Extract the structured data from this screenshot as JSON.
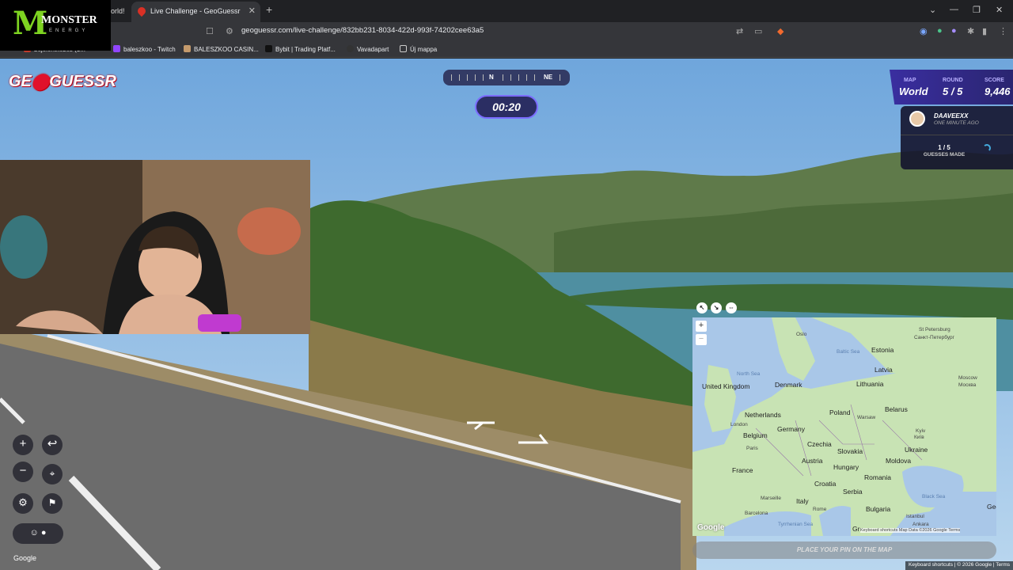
{
  "browser": {
    "prev_tab_label": "orld!",
    "active_tab_label": "Live Challenge - GeoGuessr",
    "url": "geoguessr.com/live-challenge/832bb231-8034-422d-993f-74202cee63a5",
    "bookmarks": [
      "bejelentkezés (1...",
      "baleszkoo - Twitch",
      "BALESZKOO CASIN...",
      "Bybit | Trading Platf...",
      "Vavadapart",
      "Új mappa"
    ]
  },
  "overlay_logo": {
    "word": "MONSTER",
    "sub": "ENERGY",
    "claw": "M"
  },
  "game": {
    "logo_pre": "GE",
    "logo_post": "GUESSR",
    "compass": {
      "n": "N",
      "ne": "NE"
    },
    "timer": "00:20",
    "hud": {
      "map_label": "MAP",
      "map_value": "World",
      "round_label": "ROUND",
      "round_value": "5 / 5",
      "score_label": "SCORE",
      "score_value": "9,446"
    },
    "player": {
      "name": "DAAVEEXX",
      "time": "ONE MINUTE AGO"
    },
    "guesses": {
      "count": "1 / 5",
      "label": "GUESSES MADE"
    },
    "guess_button": "PLACE YOUR PIN ON THE MAP",
    "google_label": "Google",
    "footer": "Keyboard shortcuts  |  © 2026 Google  |  Terms"
  },
  "map": {
    "labels": {
      "oslo": "Oslo",
      "st_petersburg": "St Petersburg",
      "st_petersburg_ru": "Санкт-Петербург",
      "estonia": "Estonia",
      "baltic": "Baltic Sea",
      "north_sea": "North Sea",
      "latvia": "Latvia",
      "uk": "United Kingdom",
      "denmark": "Denmark",
      "lithuania": "Lithuania",
      "moscow": "Moscow",
      "moscow_ru": "Москва",
      "netherlands": "Netherlands",
      "poland": "Poland",
      "belarus": "Belarus",
      "warsaw": "Warsaw",
      "london": "London",
      "germany": "Germany",
      "belgium": "Belgium",
      "kyiv": "Kyiv",
      "kyiv_ua": "Київ",
      "paris": "Paris",
      "czechia": "Czechia",
      "slovakia": "Slovakia",
      "ukraine": "Ukraine",
      "austria": "Austria",
      "moldova": "Moldova",
      "france": "France",
      "hungary": "Hungary",
      "romania": "Romania",
      "croatia": "Croatia",
      "serbia": "Serbia",
      "marseille": "Marseille",
      "italy": "Italy",
      "black_sea": "Black Sea",
      "bulgaria": "Bulgaria",
      "georgia": "Georg",
      "rome": "Rome",
      "barcelona": "Barcelona",
      "tyrrhenian": "Tyrrhenian Sea",
      "istanbul": "Istanbul",
      "ankara": "Ankara",
      "greece": "Gr",
      "google": "Google",
      "attribution": "Keyboard shortcuts   Map Data ©2026 Google   Terms"
    }
  },
  "colors": {
    "accent": "#7b6cff",
    "hud": "#3a2ea0",
    "land": "#c8e3b4",
    "sea": "#a9c7e8"
  }
}
